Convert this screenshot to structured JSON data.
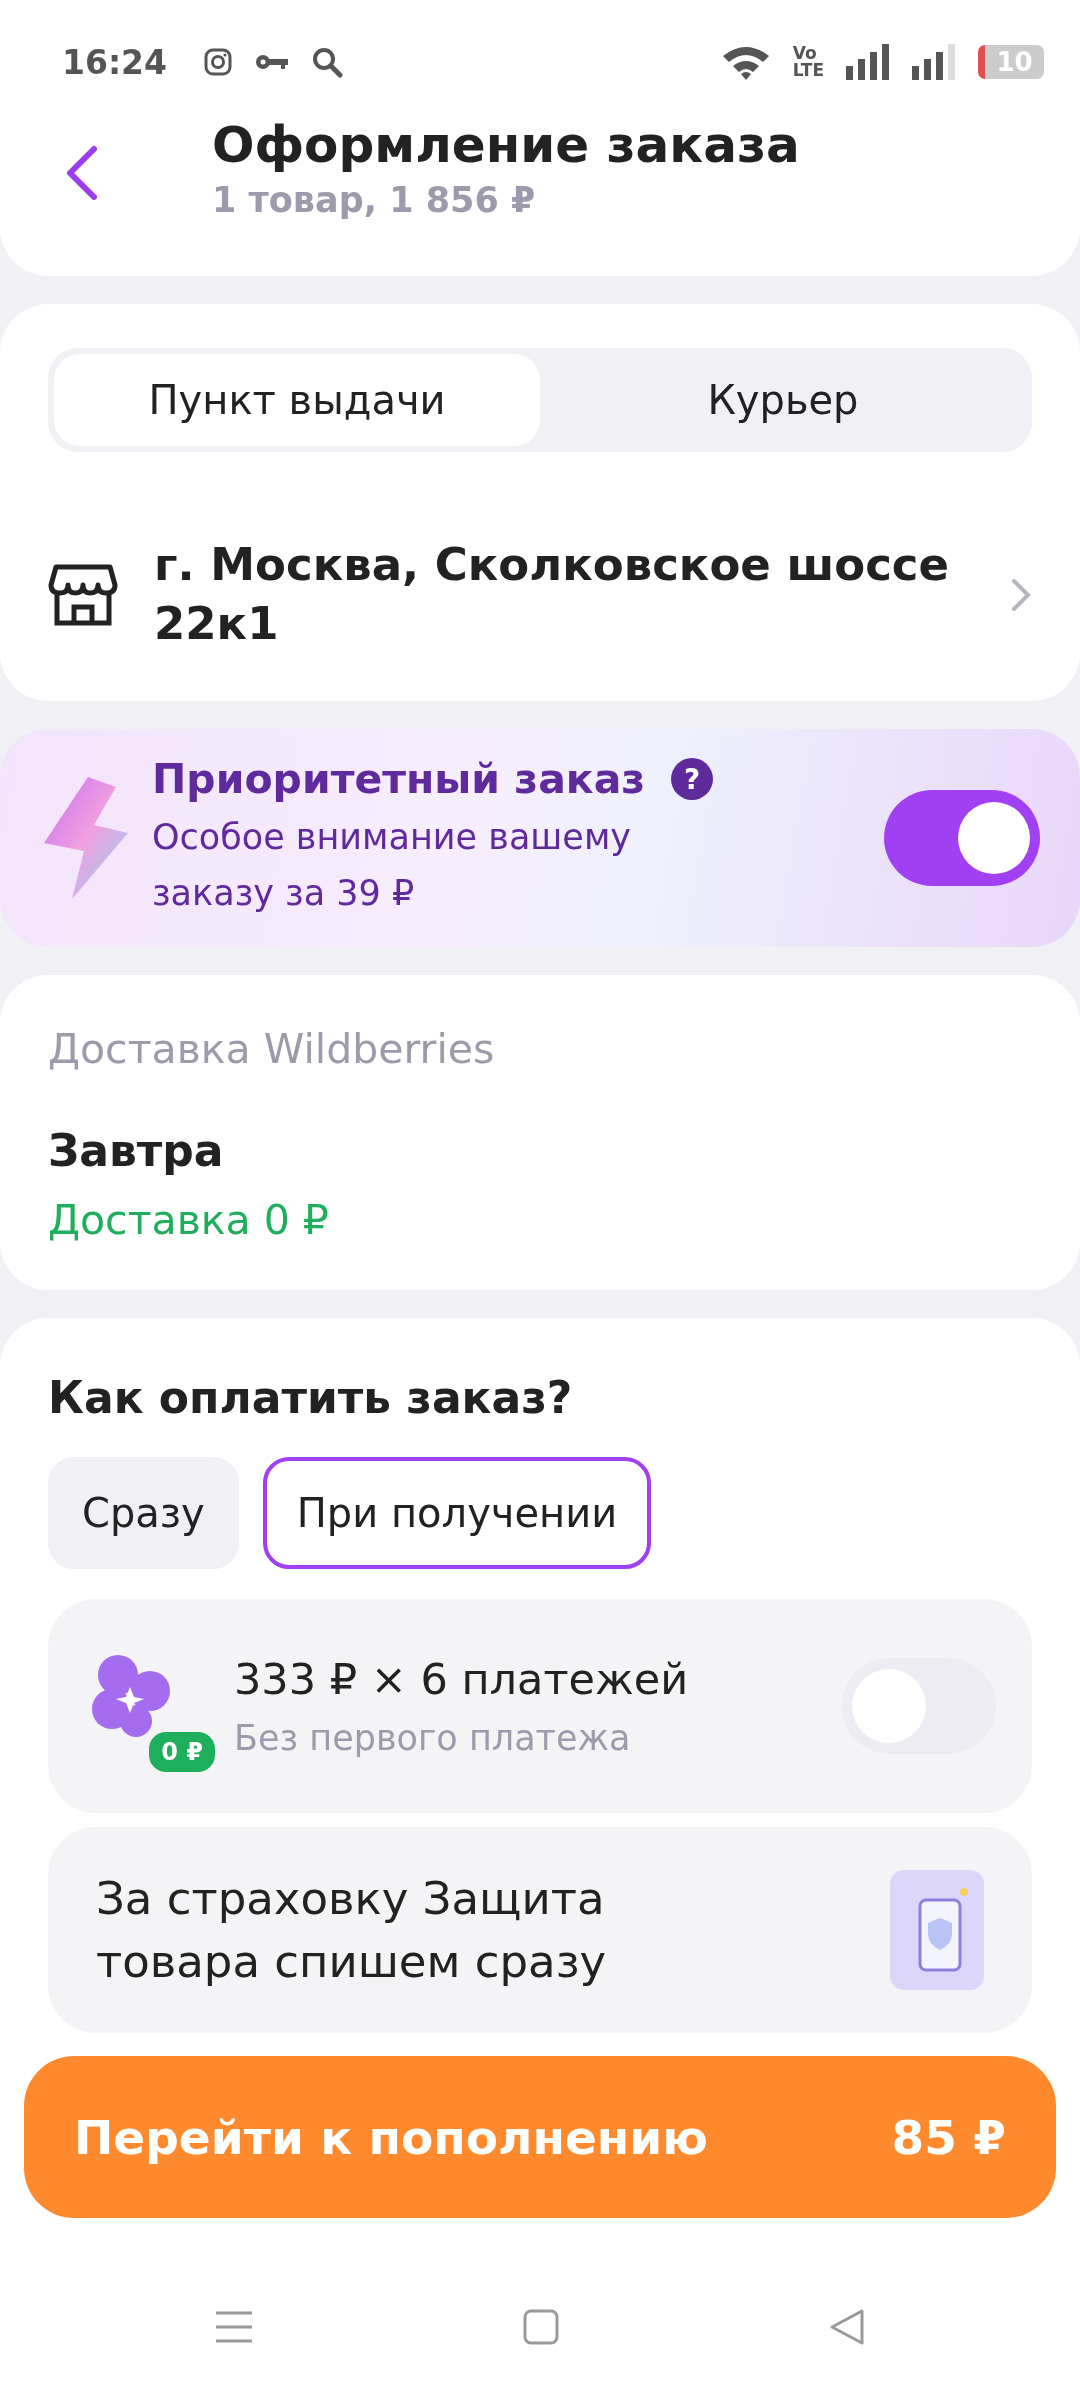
{
  "status_bar": {
    "time": "16:24",
    "volte_top": "Vo",
    "volte_bottom": "LTE",
    "battery": "10"
  },
  "header": {
    "title": "Оформление заказа",
    "subtitle": "1 товар, 1 856 ₽"
  },
  "delivery_tabs": [
    {
      "label": "Пункт выдачи",
      "selected": true
    },
    {
      "label": "Курьер",
      "selected": false
    }
  ],
  "address": {
    "text": "г. Москва, Сколковское шоссе 22к1"
  },
  "priority": {
    "title": "Приоритетный заказ",
    "help": "?",
    "description": "Особое внимание вашему заказу за 39 ₽",
    "on": true
  },
  "delivery": {
    "provider": "Доставка Wildberries",
    "date": "Завтра",
    "price": "Доставка 0 ₽"
  },
  "payment": {
    "title": "Как оплатить заказ?",
    "options": [
      {
        "label": "Сразу",
        "selected": false
      },
      {
        "label": "При получении",
        "selected": true
      }
    ],
    "installments": {
      "title": "333 ₽ × 6 платежей",
      "badge": "0 ₽",
      "subtitle": "Без первого платежа",
      "on": false
    },
    "insurance_note": "За страховку Защита товара спишем сразу"
  },
  "checkout": {
    "label": "Перейти к пополнению",
    "amount": "85 ₽"
  }
}
